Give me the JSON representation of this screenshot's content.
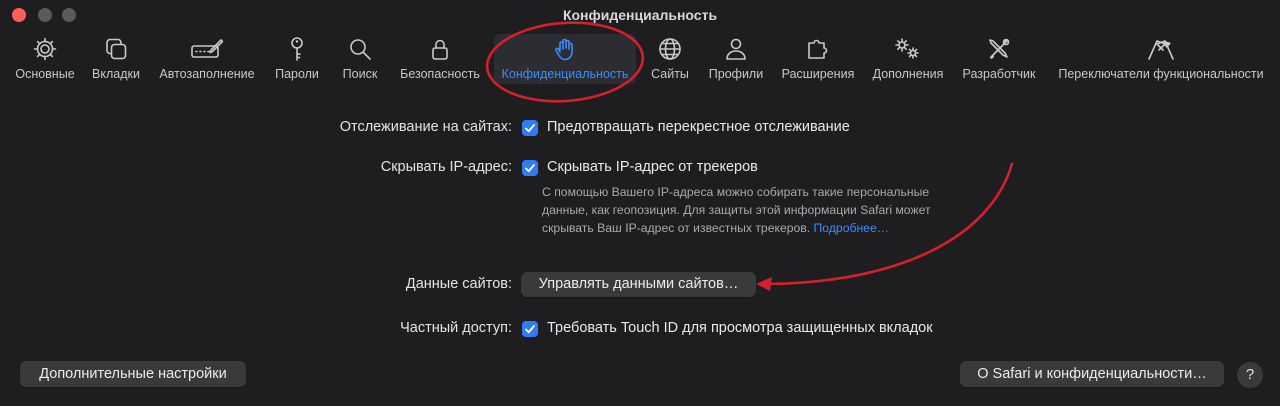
{
  "window": {
    "title": "Конфиденциальность"
  },
  "toolbar": {
    "tabs": [
      {
        "label": "Основные",
        "icon": "gear-icon"
      },
      {
        "label": "Вкладки",
        "icon": "tabs-icon"
      },
      {
        "label": "Автозаполнение",
        "icon": "pencil-field-icon"
      },
      {
        "label": "Пароли",
        "icon": "key-icon"
      },
      {
        "label": "Поиск",
        "icon": "magnifier-icon"
      },
      {
        "label": "Безопасность",
        "icon": "lock-icon"
      },
      {
        "label": "Конфиденциальность",
        "icon": "hand-icon",
        "active": true
      },
      {
        "label": "Сайты",
        "icon": "globe-icon"
      },
      {
        "label": "Профили",
        "icon": "person-icon"
      },
      {
        "label": "Расширения",
        "icon": "puzzle-icon"
      },
      {
        "label": "Дополнения",
        "icon": "gears-icon"
      },
      {
        "label": "Разработчик",
        "icon": "tools-icon"
      },
      {
        "label": "Переключатели функциональности",
        "icon": "flags-icon"
      }
    ]
  },
  "settings": {
    "tracking": {
      "label": "Отслеживание на сайтах:",
      "option": "Предотвращать перекрестное отслеживание",
      "checked": true
    },
    "ip": {
      "label": "Скрывать IP-адрес:",
      "option": "Скрывать IP-адрес от трекеров",
      "checked": true,
      "description": "С помощью Вашего IP-адреса можно собирать такие персональные данные, как геопозиция. Для защиты этой информации Safari может скрывать Ваш IP-адрес от известных трекеров.",
      "link": "Подробнее…"
    },
    "site_data": {
      "label": "Данные сайтов:",
      "button": "Управлять данными сайтов…"
    },
    "private": {
      "label": "Частный доступ:",
      "option": "Требовать Touch ID для просмотра защищенных вкладок",
      "checked": true
    }
  },
  "footer": {
    "advanced_button": "Дополнительные настройки",
    "about_button": "О Safari и конфиденциальности…",
    "help_button": "?"
  },
  "colors": {
    "accent": "#3b8cff",
    "checkbox": "#2f7cf6",
    "annotation": "#d61f2c",
    "background": "#1e1e20"
  }
}
